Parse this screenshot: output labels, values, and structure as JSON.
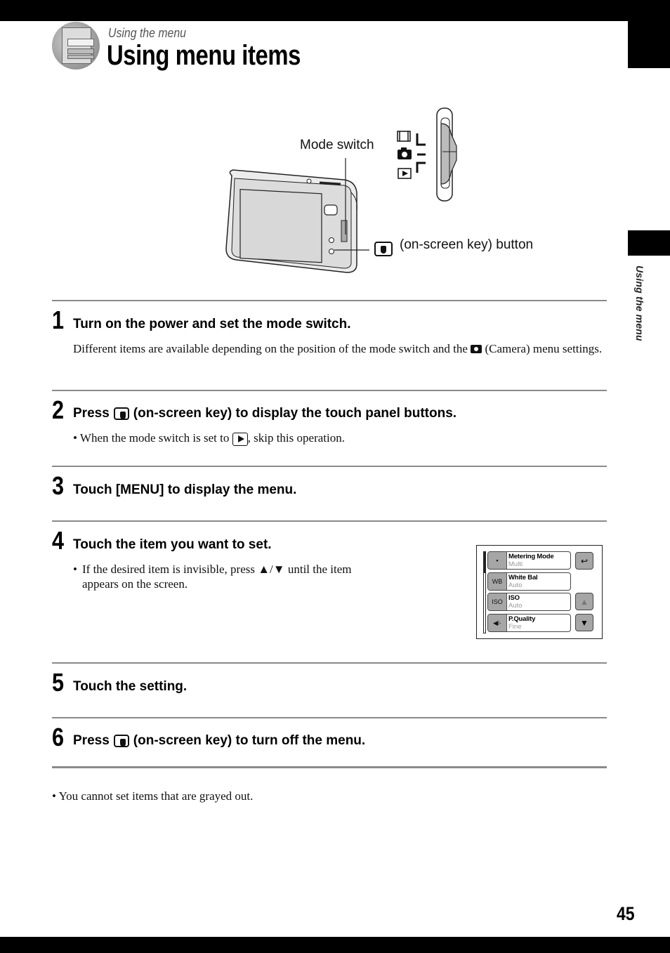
{
  "header": {
    "subtitle": "Using the menu",
    "title": "Using menu items",
    "chapter_icon": "menu-panel-icon"
  },
  "side_tab": {
    "label": "Using the menu"
  },
  "figure": {
    "mode_switch_label": "Mode switch",
    "onscreen_key_label": "(on-screen key) button",
    "switch_positions": [
      "movie-icon",
      "camera-icon",
      "playback-icon"
    ]
  },
  "steps": [
    {
      "number": "1",
      "title": "Turn on the power and set the mode switch.",
      "text_before_icon": "Different items are available depending on the position of the mode switch and the",
      "text_after_icon": "(Camera) menu settings."
    },
    {
      "number": "2",
      "title_prefix": "Press",
      "title_suffix": "(on-screen key) to display the touch panel buttons.",
      "bullet_before_icon": "When the mode switch is set to",
      "bullet_after_icon": ", skip this operation."
    },
    {
      "number": "3",
      "title": "Touch [MENU] to display the menu."
    },
    {
      "number": "4",
      "title": "Touch the item you want to set.",
      "bullet": "If the desired item is invisible, press ▲/▼ until the item appears on the screen."
    },
    {
      "number": "5",
      "title": "Touch the setting."
    },
    {
      "number": "6",
      "title_prefix": "Press",
      "title_suffix": "(on-screen key) to turn off the menu."
    }
  ],
  "menu_screen": {
    "items": [
      {
        "icon": "▪",
        "icon_name": "metering-icon",
        "name": "Metering Mode",
        "value": "Multi"
      },
      {
        "icon": "WB",
        "icon_name": "white-balance-icon",
        "name": "White Bal",
        "value": "Auto"
      },
      {
        "icon": "ISO",
        "icon_name": "iso-icon",
        "name": "ISO",
        "value": "Auto"
      },
      {
        "icon": "◀i·",
        "icon_name": "quality-icon",
        "name": "P.Quality",
        "value": "Fine"
      }
    ],
    "back_button": "↩",
    "up_button": "▲",
    "down_button": "▼"
  },
  "note": "You cannot set items that are grayed out.",
  "bullet_char": "•",
  "page_number": "45"
}
